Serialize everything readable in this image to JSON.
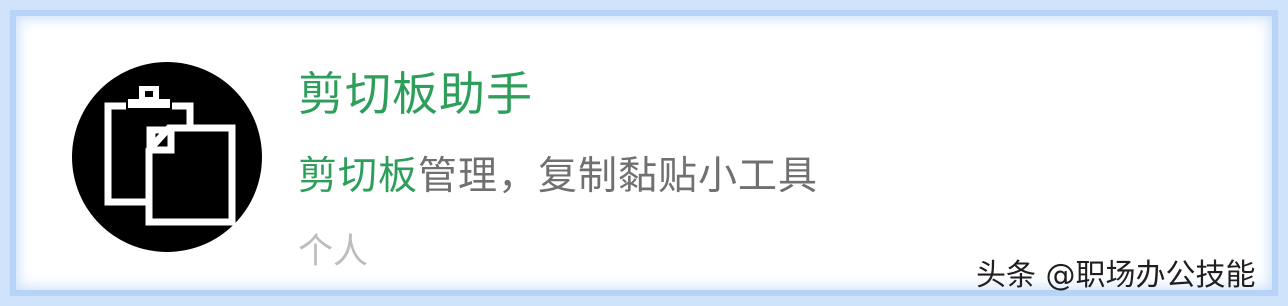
{
  "app": {
    "title": "剪切板助手",
    "description_highlight": "剪切板",
    "description_rest": "管理，复制黏贴小工具",
    "owner": "个人",
    "icon": "clipboard-icon"
  },
  "watermark": {
    "text": "头条 @职场办公技能"
  },
  "colors": {
    "title": "#2e9e5b",
    "description": "#707070",
    "owner": "#bdbdbd",
    "frame": "#cfe3fb"
  }
}
